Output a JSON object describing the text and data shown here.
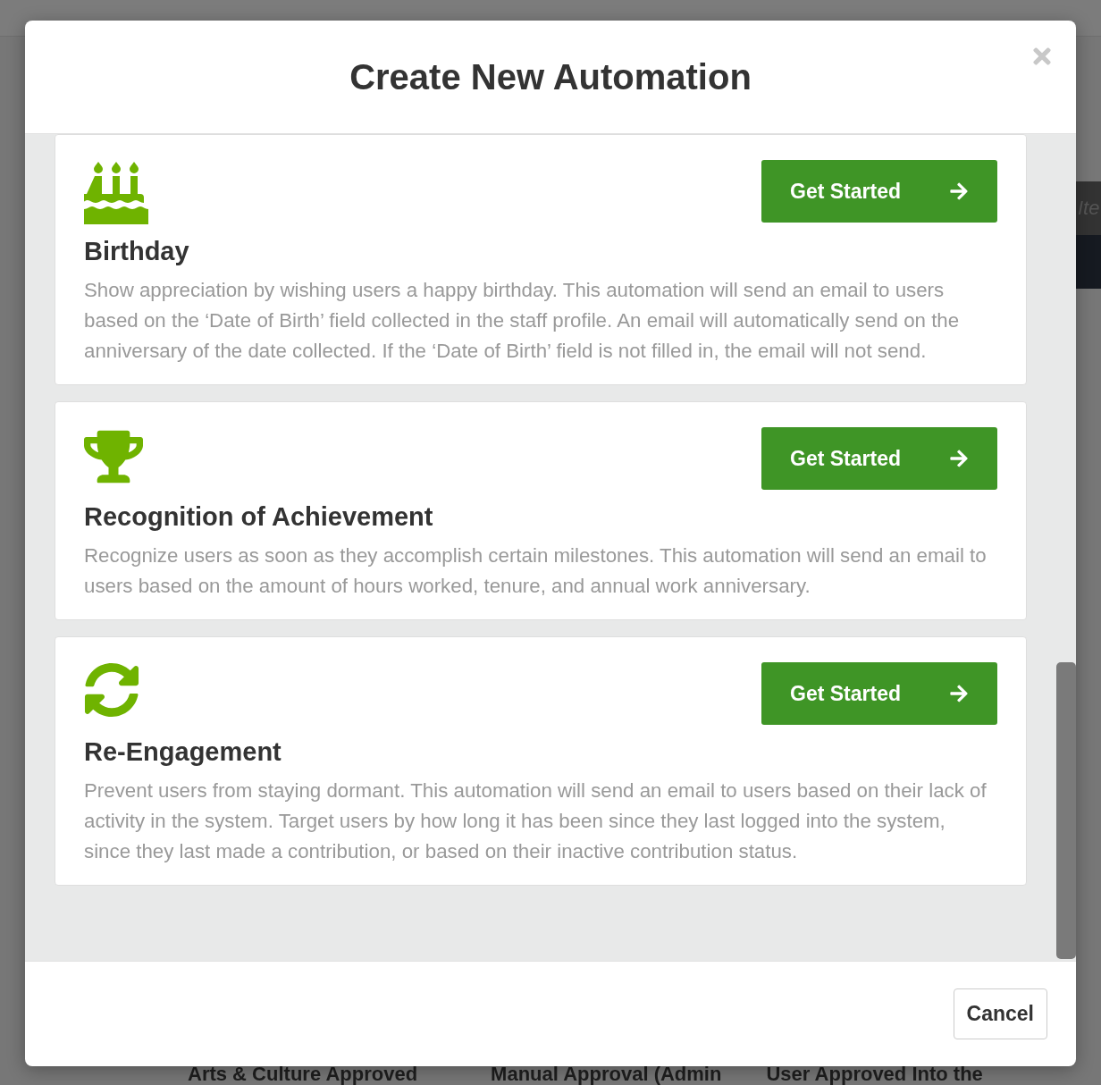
{
  "background": {
    "search_placeholder": "Ite",
    "bottom_row": [
      "Arts & Culture Approved",
      "Manual Approval (Admin",
      "User Approved Into the"
    ]
  },
  "modal": {
    "title": "Create New Automation",
    "automations": [
      {
        "kind": "birthday",
        "title": "Birthday",
        "description": "Show appreciation by wishing users a happy birthday. This automation will send an email to users based on the ‘Date of Birth’ field collected in the staff profile. An email will automatically send on the anniversary of the date collected. If the ‘Date of Birth’ field is not filled in, the email will not send.",
        "button": "Get Started"
      },
      {
        "kind": "achievement",
        "title": "Recognition of Achievement",
        "description": "Recognize users as soon as they accomplish certain milestones. This automation will send an email to users based on the amount of hours worked, tenure, and annual work anniversary.",
        "button": "Get Started"
      },
      {
        "kind": "reengagement",
        "title": "Re-Engagement",
        "description": "Prevent users from staying dormant. This automation will send an email to users based on their lack of activity in the system. Target users by how long it has been since they last logged into the system, since they last made a contribution, or based on their inactive contribution status.",
        "button": "Get Started"
      }
    ],
    "cancel": "Cancel"
  }
}
